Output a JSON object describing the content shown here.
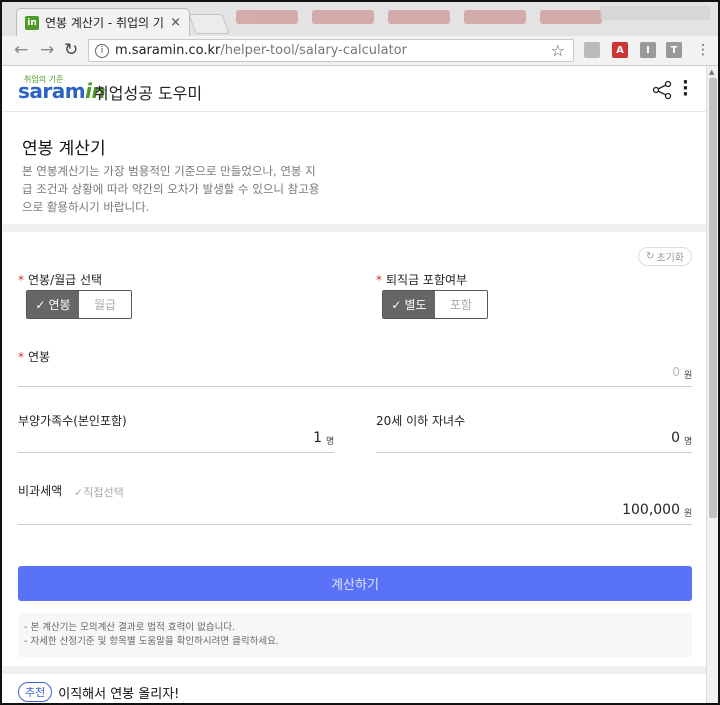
{
  "browser": {
    "tab_title": "연봉 계산기 - 취업의 기",
    "tab_favicon": "in",
    "tab_close": "×",
    "url_host": "m.saramin.co.kr",
    "url_path": "/helper-tool/salary-calculator"
  },
  "header": {
    "logo_small": "취업의 기준",
    "logo_main": "saram",
    "logo_in": "in",
    "brand_sub": "취업성공 도우미"
  },
  "intro": {
    "title": "연봉 계산기",
    "desc": "본 연봉계산기는 가장 범용적인 기준으로 만들었으나, 연봉 지급 조건과 상황에 따라 약간의 오차가 발생할 수 있으니 참고용으로 활용하시기 바랍니다."
  },
  "form": {
    "reset_label": "초기화",
    "salary_type_label": "연봉/월급 선택",
    "salary_type_on": "연봉",
    "salary_type_off": "월급",
    "severance_label": "퇴직금 포함여부",
    "severance_on": "별도",
    "severance_off": "포함",
    "salary_label": "연봉",
    "salary_value": "0",
    "salary_unit": "원",
    "dependents_label": "부양가족수(본인포함)",
    "dependents_value": "1",
    "dependents_unit": "명",
    "children_label": "20세 이하 자녀수",
    "children_value": "0",
    "children_unit": "명",
    "nontax_label": "비과세액",
    "nontax_direct": "직접선택",
    "nontax_value": "100,000",
    "nontax_unit": "원",
    "calc_button": "계산하기"
  },
  "notes": [
    "- 본 계산기는 모의계산 결과로 법적 효력이 없습니다.",
    "- 자세한 산정기준 및 항목별 도움말을 확인하시려면 클릭하세요."
  ],
  "reco": {
    "badge": "추천",
    "text": "이직해서 연봉 올리자!"
  },
  "colors": {
    "accent_button": "#5a72f8",
    "logo_blue": "#2b63c6",
    "logo_green": "#4c9a2a",
    "required": "#d33333"
  }
}
